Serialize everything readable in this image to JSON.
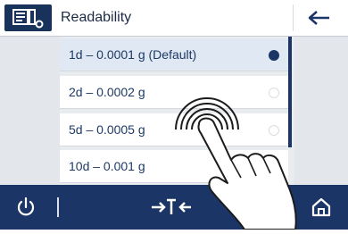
{
  "header": {
    "title": "Readability",
    "icon": "readability-settings-icon",
    "back_icon": "arrow-left-icon"
  },
  "options": [
    {
      "label": "1d – 0.0001 g (Default)",
      "selected": true
    },
    {
      "label": "2d – 0.0002 g",
      "selected": false
    },
    {
      "label": "5d – 0.0005 g",
      "selected": false
    },
    {
      "label": "10d – 0.001 g",
      "selected": false
    }
  ],
  "footer": {
    "power_icon": "power-icon",
    "tare_icon": "tare-icon",
    "home_icon": "home-icon"
  },
  "colors": {
    "primary": "#1a3566",
    "header_icon_bg": "#19325c",
    "list_bg": "#e9ecef",
    "selected_row": "#dfe8f3"
  }
}
